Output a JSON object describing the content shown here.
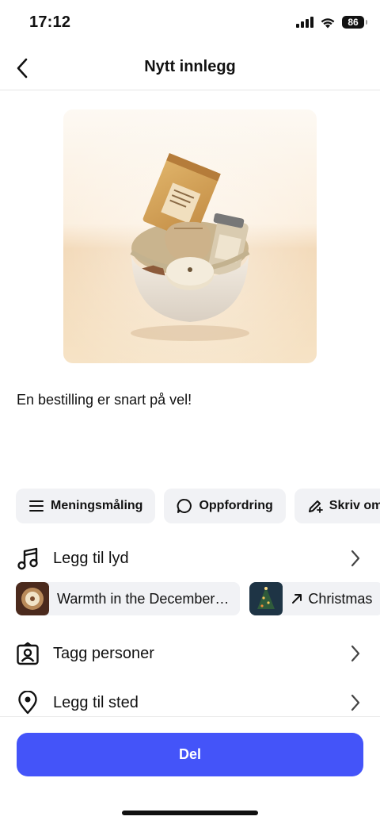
{
  "status_bar": {
    "time": "17:12",
    "battery": "86"
  },
  "nav": {
    "title": "Nytt innlegg"
  },
  "post": {
    "caption": "En bestilling er snart på vel!"
  },
  "chips": [
    {
      "label": "Meningsmåling",
      "icon": "list-icon"
    },
    {
      "label": "Oppfordring",
      "icon": "speech-bubble-icon"
    },
    {
      "label": "Skriv om",
      "icon": "pencil-sparkle-icon"
    }
  ],
  "rows": {
    "add_sound": {
      "label": "Legg til lyd",
      "icon": "music-note-icon"
    },
    "tag_people": {
      "label": "Tagg personer",
      "icon": "tag-person-icon"
    },
    "add_location": {
      "label": "Legg til sted",
      "icon": "location-pin-icon"
    }
  },
  "music_suggestions": [
    {
      "title": "Warmth in the December…"
    },
    {
      "title": "Christmas",
      "icon": "trending-arrow-icon"
    }
  ],
  "actions": {
    "share_label": "Del"
  },
  "colors": {
    "accent": "#4454f9",
    "chip_bg": "#f1f2f5"
  }
}
